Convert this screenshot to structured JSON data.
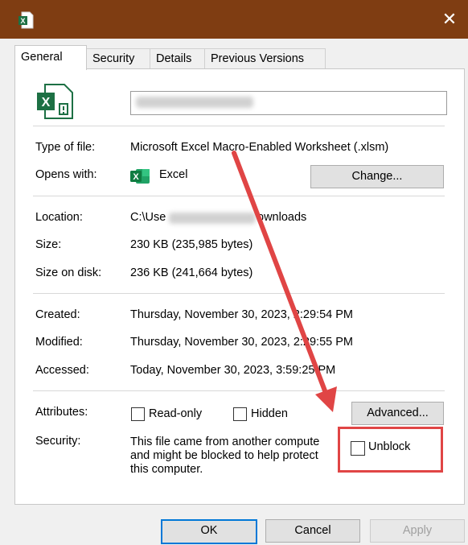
{
  "window": {
    "close_glyph": "✕"
  },
  "tabs": [
    {
      "label": "General"
    },
    {
      "label": "Security"
    },
    {
      "label": "Details"
    },
    {
      "label": "Previous Versions"
    }
  ],
  "general": {
    "type_label": "Type of file:",
    "type_value": "Microsoft Excel Macro-Enabled Worksheet (.xlsm)",
    "opens_label": "Opens with:",
    "opens_value": "Excel",
    "change_button": "Change...",
    "location_label": "Location:",
    "location_prefix": "C:\\Use",
    "location_suffix": "ownloads",
    "size_label": "Size:",
    "size_value": "230 KB (235,985 bytes)",
    "disk_label": "Size on disk:",
    "disk_value": "236 KB (241,664 bytes)",
    "created_label": "Created:",
    "created_value": "Thursday, November 30, 2023, 2:29:54 PM",
    "modified_label": "Modified:",
    "modified_value": "Thursday, November 30, 2023, 2:29:55 PM",
    "accessed_label": "Accessed:",
    "accessed_value": "Today, November 30, 2023, 3:59:25 PM",
    "attributes_label": "Attributes:",
    "readonly_label": "Read-only",
    "hidden_label": "Hidden",
    "advanced_button": "Advanced...",
    "security_label": "Security:",
    "security_line1": "This file came from another compute",
    "security_line2": "and might be blocked to help protect",
    "security_line3": "this computer.",
    "unblock_label": "Unblock"
  },
  "buttons": {
    "ok": "OK",
    "cancel": "Cancel",
    "apply": "Apply"
  },
  "icons": {
    "title": "excel-file-icon",
    "large": "excel-macro-file-icon",
    "small": "excel-app-icon"
  },
  "colors": {
    "titlebar": "#7f3d12",
    "excel_green": "#1d7044",
    "annotation_red": "#e04545",
    "focus_blue": "#0078d7"
  }
}
